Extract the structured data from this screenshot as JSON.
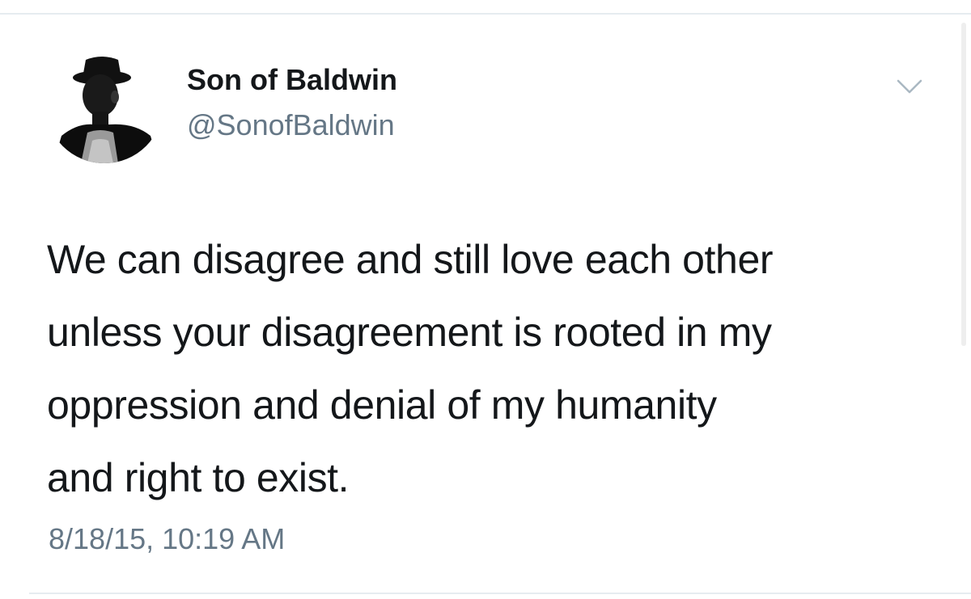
{
  "tweet": {
    "author": {
      "display_name": "Son of Baldwin",
      "handle": "@SonofBaldwin",
      "avatar_icon": "profile-photo"
    },
    "menu_icon": "chevron-down-icon",
    "text_lines": [
      "We can disagree and still love each other",
      "unless your disagreement is rooted in my",
      "oppression and denial of my humanity",
      "and right to exist."
    ],
    "timestamp": "8/18/15, 10:19 AM"
  },
  "colors": {
    "text_primary": "#14171a",
    "text_secondary": "#657786",
    "divider": "#e6ecf0",
    "chevron": "#aab8c2"
  }
}
